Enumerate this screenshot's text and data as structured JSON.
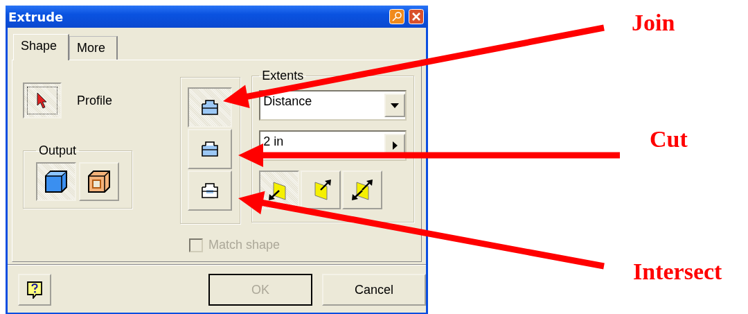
{
  "window": {
    "title": "Extrude"
  },
  "tabs": [
    {
      "label": "Shape",
      "selected": true
    },
    {
      "label": "More",
      "selected": false
    }
  ],
  "profile": {
    "label": "Profile",
    "selected": true
  },
  "output": {
    "title": "Output",
    "options": [
      {
        "kind": "solid",
        "selected": true
      },
      {
        "kind": "surface",
        "selected": false
      }
    ]
  },
  "operations": [
    {
      "kind": "join",
      "selected": true
    },
    {
      "kind": "cut",
      "selected": false
    },
    {
      "kind": "intersect",
      "selected": false
    }
  ],
  "extents": {
    "title": "Extents",
    "type": "Distance",
    "distance": "2 in",
    "directions": [
      {
        "kind": "forward",
        "selected": true
      },
      {
        "kind": "reverse",
        "selected": false
      },
      {
        "kind": "symmetric",
        "selected": false
      }
    ]
  },
  "match_shape": {
    "label": "Match shape",
    "checked": false,
    "disabled": true
  },
  "buttons": [
    {
      "label": "OK",
      "disabled": true
    },
    {
      "label": "Cancel",
      "disabled": false
    }
  ],
  "annotations": [
    {
      "label": "Join"
    },
    {
      "label": "Cut"
    },
    {
      "label": "Intersect"
    }
  ]
}
